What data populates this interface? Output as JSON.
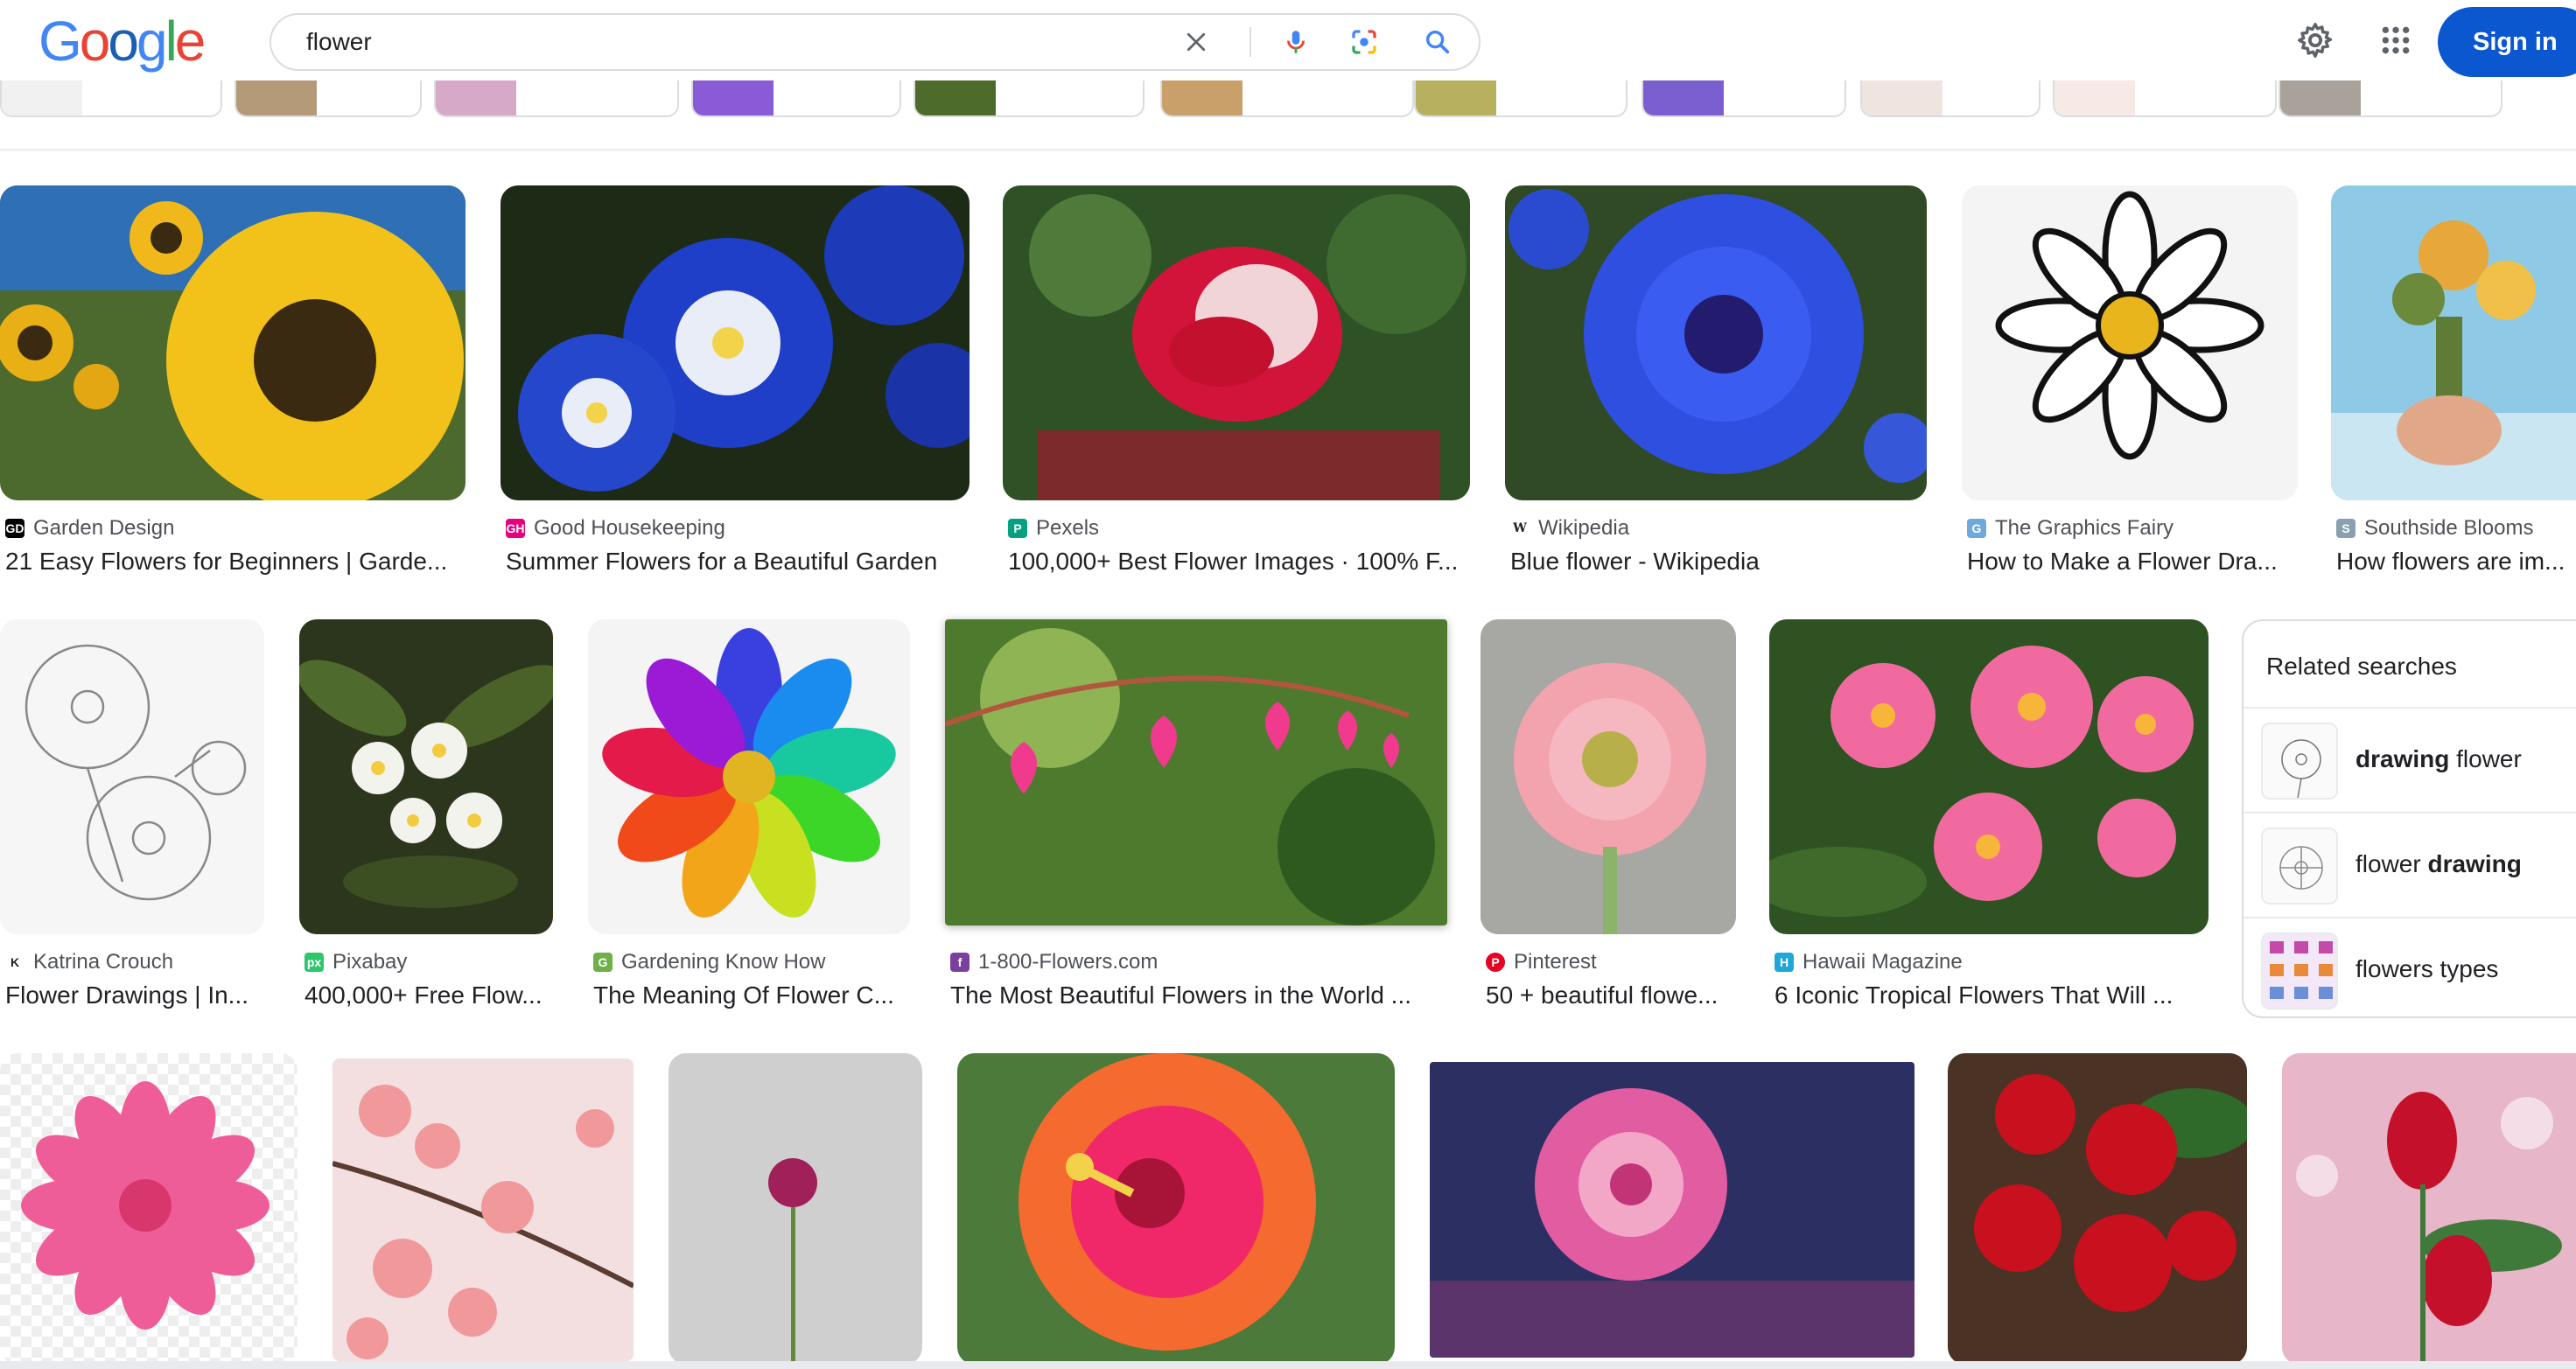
{
  "header": {
    "logo_letters": [
      "G",
      "o",
      "o",
      "g",
      "l",
      "e"
    ],
    "logo_colors": [
      "#4285f4",
      "#ea4335",
      "#1a5fb4",
      "#4285f4",
      "#34a853",
      "#ea4335"
    ],
    "search_value": "flower",
    "search_placeholder": "",
    "sign_in_label": "Sign in",
    "icons": [
      "close-icon",
      "microphone-icon",
      "camera-icon",
      "search-icon",
      "settings-gear-icon",
      "apps-grid-icon"
    ]
  },
  "colors": {
    "accent": "#0b57d0",
    "title_text": "#202124",
    "source_text": "#4d5156",
    "border": "#dadce0"
  },
  "results": {
    "row1": [
      {
        "source": "Garden Design",
        "favicon": "GD",
        "favicon_color": "#000000",
        "title": "21 Easy Flowers for Beginners | Garde...",
        "image": "sunflower"
      },
      {
        "source": "Good Housekeeping",
        "favicon": "GH",
        "favicon_color": "#e6007e",
        "title": "Summer Flowers for a Beautiful Garden",
        "image": "blue-morning-glory"
      },
      {
        "source": "Pexels",
        "favicon": "P",
        "favicon_color": "#05a081",
        "title": "100,000+ Best Flower Images · 100% F...",
        "image": "red-rose"
      },
      {
        "source": "Wikipedia",
        "favicon": "W",
        "favicon_color": "#ffffff",
        "title": "Blue flower - Wikipedia",
        "image": "cornflower"
      },
      {
        "source": "The Graphics Fairy",
        "favicon": "G",
        "favicon_color": "#6fa8dc",
        "title": "How to Make a Flower Dra...",
        "image": "daisy-drawing"
      },
      {
        "source": "Southside Blooms",
        "favicon": "S",
        "favicon_color": "#8aa0b0",
        "title": "How flowers are im...",
        "image": "hands-bouquet"
      }
    ],
    "row2": [
      {
        "source": "Katrina Crouch",
        "favicon": "K",
        "favicon_color": "#ffffff",
        "title": "Flower Drawings | In...",
        "image": "pencil-sketch"
      },
      {
        "source": "Pixabay",
        "favicon": "px",
        "favicon_color": "#2ec66d",
        "title": "400,000+ Free Flow...",
        "image": "plumeria-white"
      },
      {
        "source": "Gardening Know How",
        "favicon": "G",
        "favicon_color": "#6fb04a",
        "title": "The Meaning Of Flower C...",
        "image": "rainbow-flower"
      },
      {
        "source": "1-800-Flowers.com",
        "favicon": "f",
        "favicon_color": "#7b3fa0",
        "title": "The Most Beautiful Flowers in the World ...",
        "image": "bleeding-heart"
      },
      {
        "source": "Pinterest",
        "favicon": "P",
        "favicon_color": "#e60023",
        "title": "50 + beautiful flowe...",
        "image": "pink-gerbera"
      },
      {
        "source": "Hawaii Magazine",
        "favicon": "H",
        "favicon_color": "#1ea7d8",
        "title": "6 Iconic Tropical Flowers That Will ...",
        "image": "pink-plumeria"
      }
    ],
    "row3": [
      {
        "image": "pink-daisy-transparent"
      },
      {
        "image": "cherry-blossom"
      },
      {
        "image": "carnation"
      },
      {
        "image": "hibiscus"
      },
      {
        "image": "dahlia"
      },
      {
        "image": "red-roses-wood"
      },
      {
        "image": "red-roses-bokeh"
      }
    ]
  },
  "related": {
    "title": "Related searches",
    "items": [
      {
        "bold": "drawing",
        "plain": " flower",
        "bold_first": true
      },
      {
        "plain": "flower ",
        "bold": "drawing",
        "bold_first": false
      },
      {
        "plain": "flowers types",
        "bold": "",
        "bold_first": false
      }
    ]
  }
}
